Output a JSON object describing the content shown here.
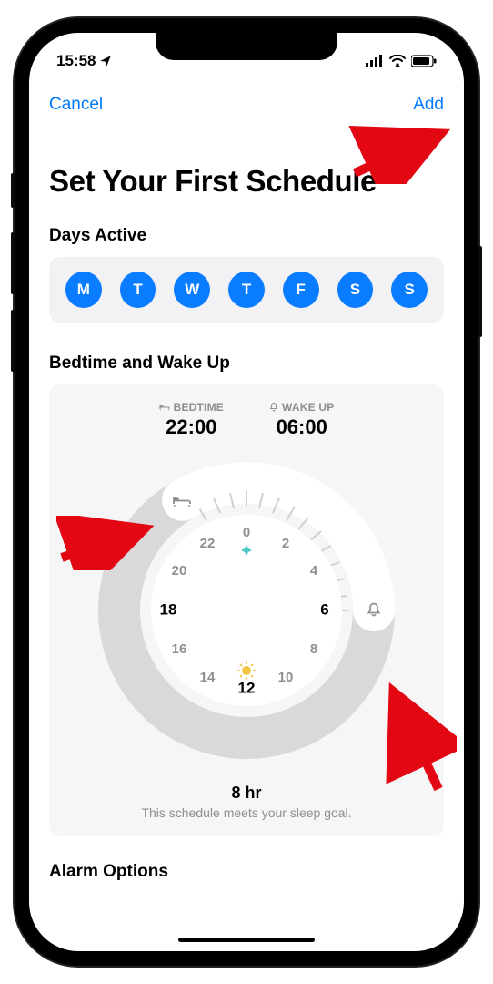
{
  "status": {
    "time": "15:58",
    "location_icon": "◤"
  },
  "nav": {
    "cancel": "Cancel",
    "add": "Add"
  },
  "title": "Set Your First Schedule",
  "days_active": {
    "heading": "Days Active",
    "days": [
      "M",
      "T",
      "W",
      "T",
      "F",
      "S",
      "S"
    ]
  },
  "bedtime": {
    "heading": "Bedtime and Wake Up",
    "bedtime_label": "BEDTIME",
    "bedtime_value": "22:00",
    "wakeup_label": "WAKE UP",
    "wakeup_value": "06:00",
    "clock_hours": {
      "top": "0",
      "h2": "2",
      "h4": "4",
      "h6": "6",
      "h8": "8",
      "h10": "10",
      "bottom": "12",
      "h14": "14",
      "h16": "16",
      "h18": "18",
      "h20": "20",
      "h22": "22"
    },
    "duration": "8 hr",
    "goal_text": "This schedule meets your sleep goal."
  },
  "alarm_heading": "Alarm Options"
}
